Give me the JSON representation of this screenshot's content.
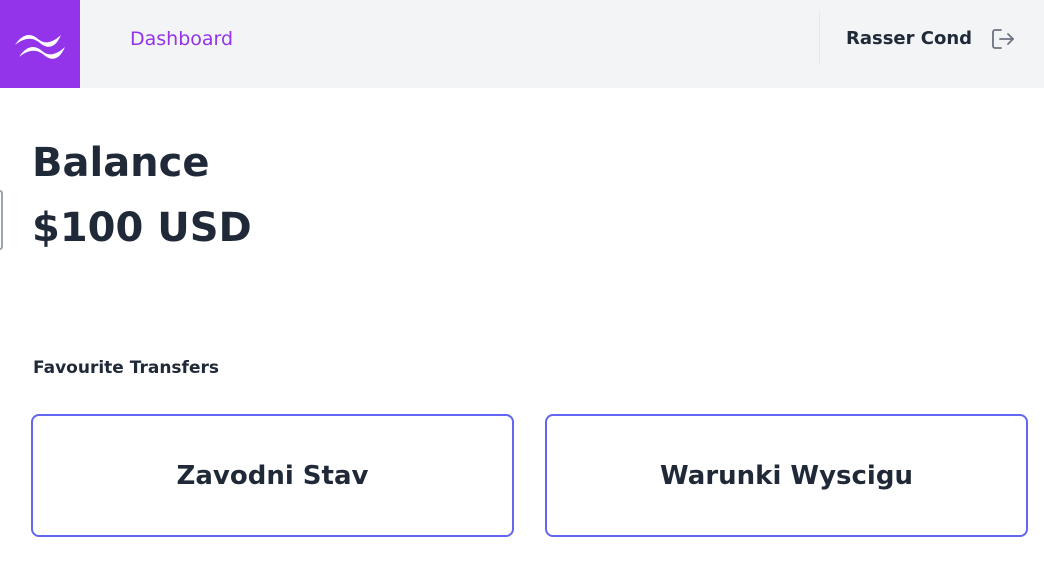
{
  "header": {
    "logo_icon": "wave-logo-icon",
    "nav_link": "Dashboard",
    "user_name": "Rasser Cond",
    "logout_icon": "logout-arrow-icon",
    "accent_color": "#9333ea"
  },
  "balance": {
    "title": "Balance",
    "amount": "$100 USD"
  },
  "favourites": {
    "label": "Favourite Transfers",
    "cards": [
      {
        "label": "Zavodni Stav"
      },
      {
        "label": "Warunki Wyscigu"
      }
    ],
    "card_border_color": "#6366f1"
  }
}
